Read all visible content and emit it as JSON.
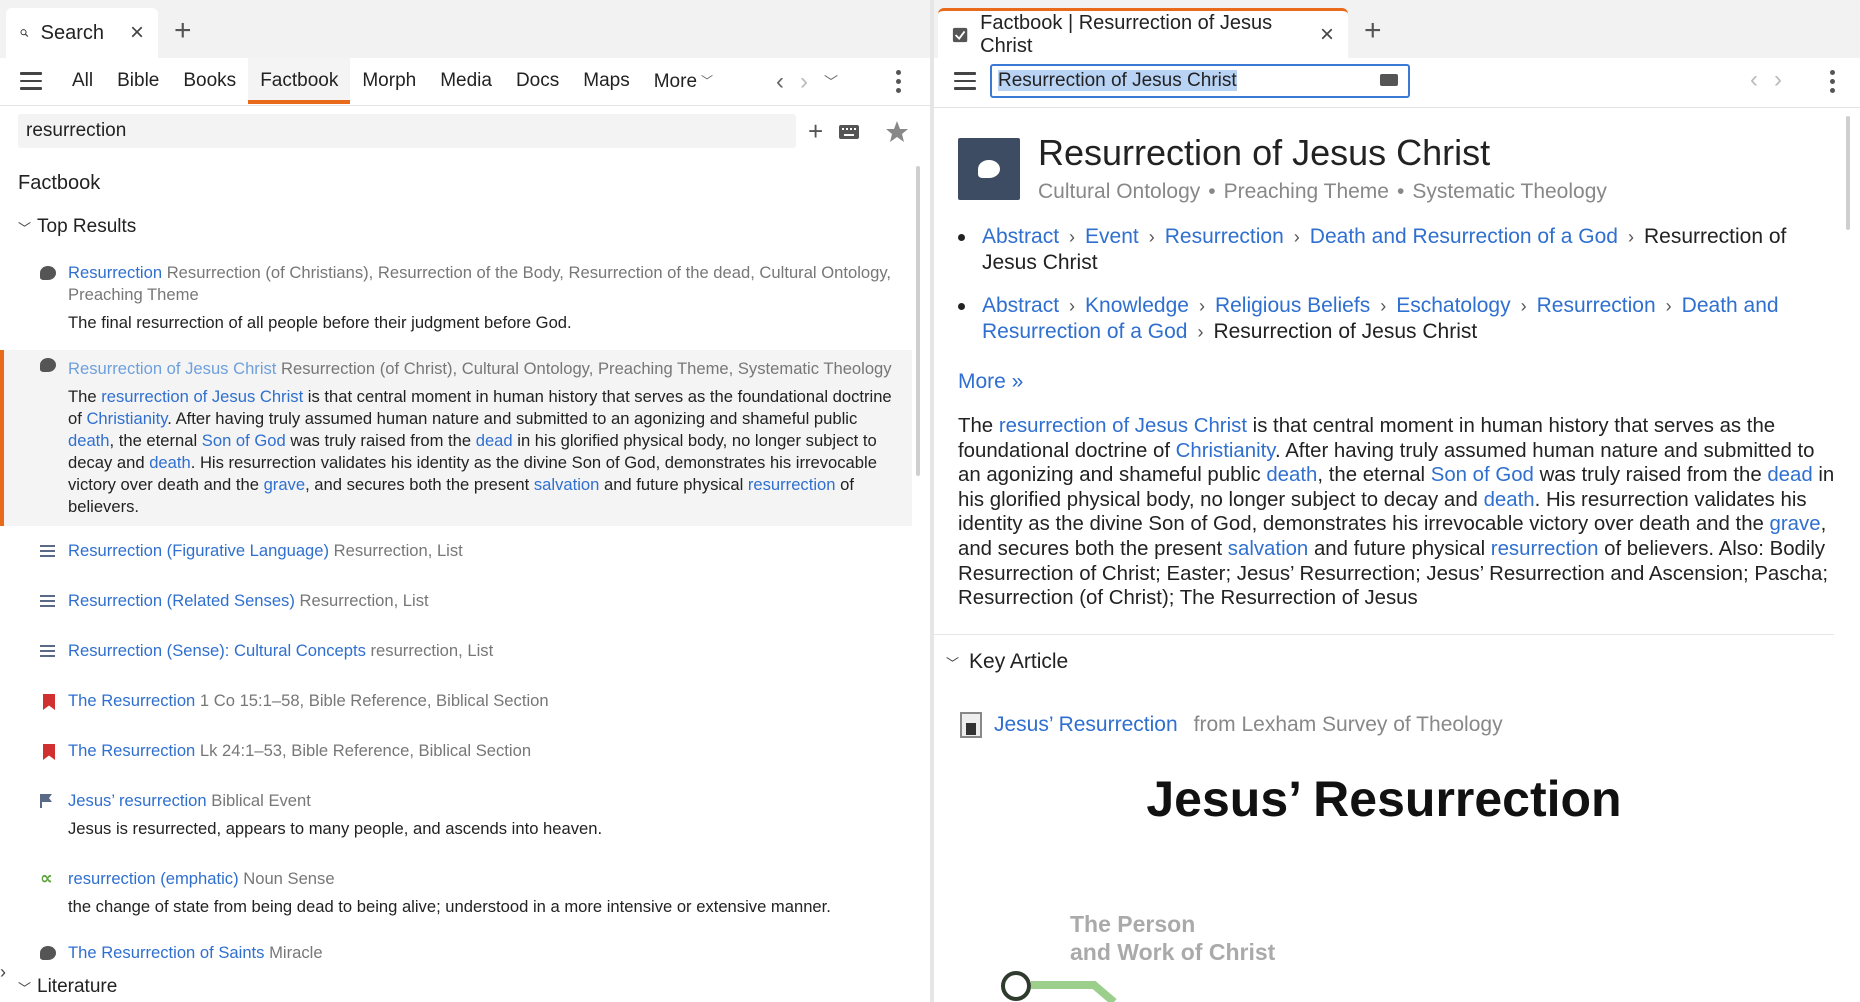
{
  "left": {
    "tab": {
      "label": "Search",
      "close": "×",
      "add": "+"
    },
    "nav": {
      "items": [
        "All",
        "Bible",
        "Books",
        "Factbook",
        "Morph",
        "Media",
        "Docs",
        "Maps",
        "More"
      ],
      "active": "Factbook"
    },
    "search": {
      "value": "resurrection"
    },
    "section_title": "Factbook",
    "top_results_label": "Top Results",
    "results": [
      {
        "icon": "speech-bubble-icon",
        "title": "Resurrection",
        "meta": "Resurrection (of Christians), Resurrection of the Body, Resurrection of the dead, Cultural Ontology, Preaching Theme",
        "desc": "The final resurrection of all people before their judgment before God."
      },
      {
        "icon": "speech-bubble-icon",
        "title": "Resurrection of Jesus Christ",
        "meta": "Resurrection (of Christ), Cultural Ontology, Preaching Theme, Systematic Theology",
        "selected": true,
        "desc_parts": [
          {
            "t": "The "
          },
          {
            "t": "resurrection of Jesus Christ",
            "link": true
          },
          {
            "t": " is that central moment in human history that serves as the foundational doctrine of "
          },
          {
            "t": "Christianity",
            "link": true
          },
          {
            "t": ". After having truly assumed human nature and submitted to an agonizing and shameful public "
          },
          {
            "t": "death",
            "link": true
          },
          {
            "t": ", the eternal "
          },
          {
            "t": "Son of God",
            "link": true
          },
          {
            "t": " was truly raised from the "
          },
          {
            "t": "dead",
            "link": true
          },
          {
            "t": " in his glorified physical body, no longer subject to decay and "
          },
          {
            "t": "death",
            "link": true
          },
          {
            "t": ". His resurrection validates his identity as the divine Son of God, demonstrates his irrevocable victory over death and the "
          },
          {
            "t": "grave",
            "link": true
          },
          {
            "t": ", and secures both the present "
          },
          {
            "t": "salvation",
            "link": true
          },
          {
            "t": " and future physical "
          },
          {
            "t": "resurrection",
            "link": true
          },
          {
            "t": " of believers."
          }
        ]
      },
      {
        "icon": "list-icon",
        "title": "Resurrection (Figurative Language)",
        "meta": "Resurrection, List"
      },
      {
        "icon": "list-icon",
        "title": "Resurrection (Related Senses)",
        "meta": "Resurrection, List"
      },
      {
        "icon": "list-icon",
        "title": "Resurrection (Sense): Cultural Concepts",
        "meta": "resurrection, List"
      },
      {
        "icon": "bookmark-icon",
        "title": "The Resurrection",
        "meta": "1 Co 15:1–58, Bible Reference, Biblical Section"
      },
      {
        "icon": "bookmark-icon",
        "title": "The Resurrection",
        "meta": "Lk 24:1–53, Bible Reference, Biblical Section"
      },
      {
        "icon": "flag-icon",
        "title": "Jesus’ resurrection",
        "meta": "Biblical Event",
        "desc": "Jesus is resurrected, appears to many people, and ascends into heaven."
      },
      {
        "icon": "alpha-icon",
        "title": "resurrection (emphatic)",
        "meta": "Noun Sense",
        "desc": "the change of state from being dead to being alive; understood in a more intensive or extensive manner."
      },
      {
        "icon": "speech-bubble-icon",
        "title": "The Resurrection of Saints",
        "meta": "Miracle"
      }
    ],
    "literature_label": "Literature"
  },
  "right": {
    "tab": {
      "label": "Factbook | Resurrection of Jesus Christ",
      "close": "×",
      "add": "+"
    },
    "input_value": "Resurrection of Jesus Christ",
    "title": "Resurrection of Jesus Christ",
    "subtitle": [
      "Cultural Ontology",
      "Preaching Theme",
      "Systematic Theology"
    ],
    "breadcrumbs": [
      {
        "links": [
          "Abstract",
          "Event",
          "Resurrection",
          "Death and Resurrection of a God"
        ],
        "current": "Resurrection of Jesus Christ"
      },
      {
        "links": [
          "Abstract",
          "Knowledge",
          "Religious Beliefs",
          "Eschatology",
          "Resurrection",
          "Death and Resurrection of a God"
        ],
        "current": "Resurrection of Jesus Christ"
      }
    ],
    "more_label": "More »",
    "desc_parts": [
      {
        "t": "The "
      },
      {
        "t": "resurrection of Jesus Christ",
        "link": true
      },
      {
        "t": " is that central moment in human history that serves as the foundational doctrine of "
      },
      {
        "t": "Christianity",
        "link": true
      },
      {
        "t": ". After having truly assumed human nature and submitted to an agonizing and shameful public "
      },
      {
        "t": "death",
        "link": true
      },
      {
        "t": ", the eternal "
      },
      {
        "t": "Son of God",
        "link": true
      },
      {
        "t": " was truly raised from the "
      },
      {
        "t": "dead",
        "link": true
      },
      {
        "t": " in his glorified physical body, no longer subject to decay and "
      },
      {
        "t": "death",
        "link": true
      },
      {
        "t": ". His resurrection validates his identity as the divine Son of God, demonstrates his irrevocable victory over death and the "
      },
      {
        "t": "grave",
        "link": true
      },
      {
        "t": ", and secures both the present "
      },
      {
        "t": "salvation",
        "link": true
      },
      {
        "t": " and future physical "
      },
      {
        "t": "resurrection",
        "link": true
      },
      {
        "t": " of believers. Also: Bodily Resurrection of Christ; Easter; Jesus’ Resurrection; Jesus’ Resurrection and Ascension; Pascha; Resurrection (of Christ); The Resurrection of Jesus"
      }
    ],
    "key_article": {
      "label": "Key Article",
      "title": "Jesus’ Resurrection",
      "source": "from Lexham Survey of Theology"
    },
    "article_heading": "Jesus’ Resurrection",
    "diagram_text": [
      "The Person",
      "and Work of Christ"
    ]
  },
  "colors": {
    "accent": "#e86a1a",
    "link": "#2f6fcf",
    "selection": "#b9d3f5"
  }
}
